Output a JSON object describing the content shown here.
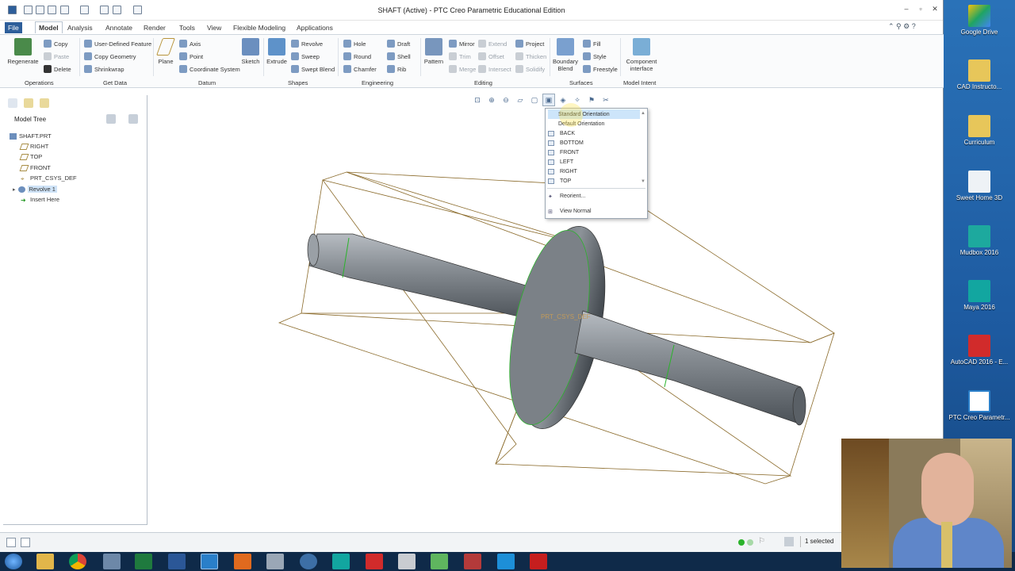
{
  "window": {
    "title": "SHAFT (Active) - PTC Creo Parametric Educational Edition",
    "minimize_label": "–",
    "maximize_label": "▫",
    "close_label": "✕"
  },
  "tabs": [
    "File",
    "Model",
    "Analysis",
    "Annotate",
    "Tools",
    "Render",
    "View",
    "Flexible Modeling",
    "Applications"
  ],
  "ribbon": {
    "operations": {
      "regenerate": "Regenerate",
      "copy": "Copy",
      "paste": "Paste",
      "delete": "Delete",
      "group": "Operations"
    },
    "get_data": {
      "udf": "User-Defined Feature",
      "copy_geometry": "Copy Geometry",
      "shrinkwrap": "Shrinkwrap",
      "group": "Get Data"
    },
    "datum": {
      "plane": "Plane",
      "axis": "Axis",
      "point": "Point",
      "csys": "Coordinate System",
      "sketch": "Sketch",
      "group": "Datum"
    },
    "shapes": {
      "extrude": "Extrude",
      "revolve": "Revolve",
      "sweep": "Sweep",
      "swept_blend": "Swept Blend",
      "group": "Shapes"
    },
    "engineering": {
      "hole": "Hole",
      "round": "Round",
      "chamfer": "Chamfer",
      "draft": "Draft",
      "shell": "Shell",
      "rib": "Rib",
      "group": "Engineering"
    },
    "editing": {
      "pattern": "Pattern",
      "mirror": "Mirror",
      "trim": "Trim",
      "merge": "Merge",
      "extend": "Extend",
      "offset": "Offset",
      "intersect": "Intersect",
      "project": "Project",
      "thicken": "Thicken",
      "solidify": "Solidify",
      "group": "Editing"
    },
    "surfaces": {
      "boundary_blend": "Boundary Blend",
      "fill": "Fill",
      "style": "Style",
      "freestyle": "Freestyle",
      "group": "Surfaces"
    },
    "model_intent": {
      "component_interface": "Component interface",
      "group": "Model Intent"
    }
  },
  "model_tree": {
    "header": "Model Tree",
    "items": [
      "SHAFT.PRT",
      "RIGHT",
      "TOP",
      "FRONT",
      "PRT_CSYS_DEF",
      "Revolve 1",
      "Insert Here"
    ]
  },
  "view_menu": {
    "items": [
      "Standard Orientation",
      "Default Orientation",
      "BACK",
      "BOTTOM",
      "FRONT",
      "LEFT",
      "RIGHT",
      "TOP",
      "Reorient...",
      "View Normal"
    ],
    "highlighted": "Standard Orientation"
  },
  "model": {
    "csys_label": "PRT_CSYS_DEF"
  },
  "status": {
    "selected": "1 selected"
  },
  "desktop_icons": [
    "Google Drive",
    "CAD Instructo...",
    "Curriculum",
    "Sweet Home 3D",
    "Mudbox 2016",
    "Maya 2016",
    "AutoCAD 2016 - E...",
    "PTC Creo Parametr..."
  ],
  "colors": {
    "accent": "#2d5e9a",
    "model_edge": "#8a6a2a",
    "selection_green": "#2bb32b"
  }
}
